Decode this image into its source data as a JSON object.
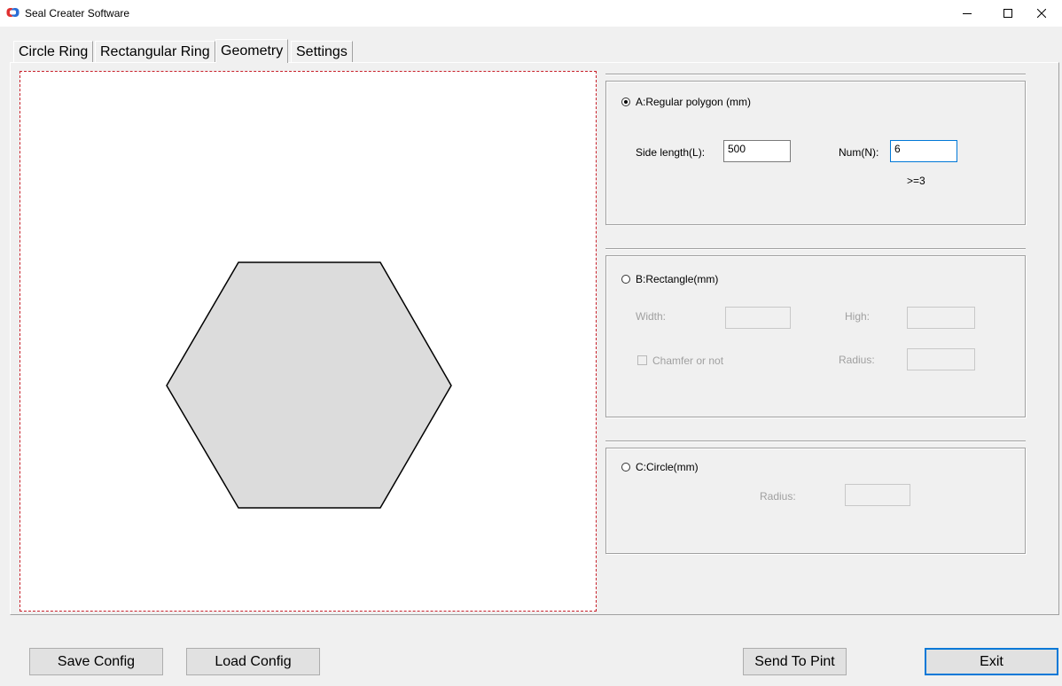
{
  "window": {
    "title": "Seal Creater Software"
  },
  "tabs": [
    {
      "label": "Circle Ring"
    },
    {
      "label": "Rectangular Ring"
    },
    {
      "label": "Geometry"
    },
    {
      "label": "Settings"
    }
  ],
  "active_tab": "Geometry",
  "preview": {
    "shape": "hexagon",
    "sides": 6
  },
  "polygon": {
    "label": "A:Regular polygon (mm)",
    "selected": true,
    "side_length_label": "Side length(L):",
    "side_length_value": "500",
    "num_label": "Num(N):",
    "num_value": "6",
    "constraint": ">=3"
  },
  "rectangle": {
    "label": "B:Rectangle(mm)",
    "selected": false,
    "width_label": "Width:",
    "high_label": "High:",
    "chamfer_label": "Chamfer or not",
    "radius_label": "Radius:"
  },
  "circle": {
    "label": "C:Circle(mm)",
    "selected": false,
    "radius_label": "Radius:"
  },
  "buttons": {
    "save": "Save Config",
    "load": "Load Config",
    "send": "Send To Pint",
    "exit": "Exit"
  },
  "colors": {
    "dashed_border": "#c8202a",
    "shape_fill": "#dcdcdc",
    "default_button_border": "#0078d7"
  }
}
